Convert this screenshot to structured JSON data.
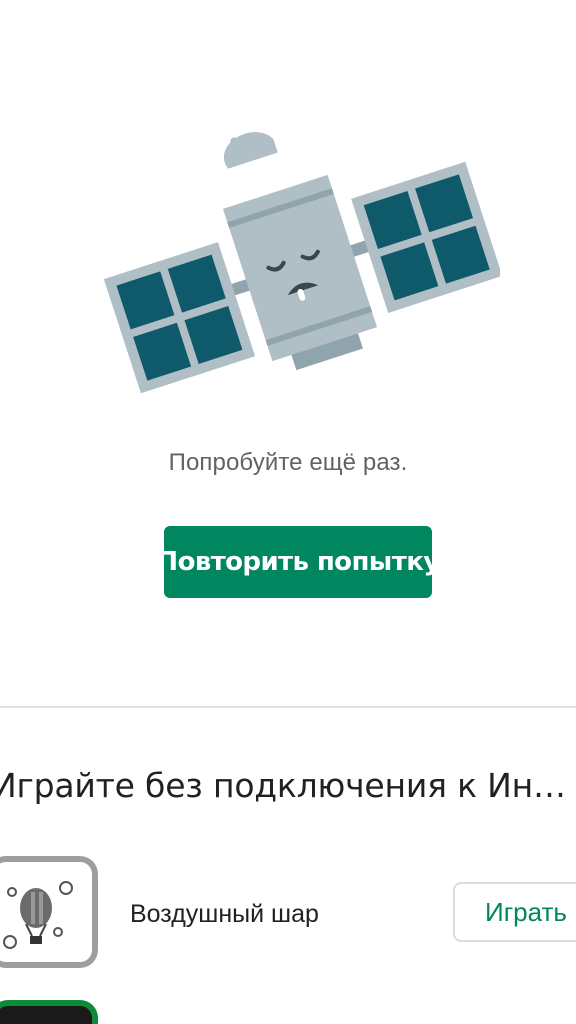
{
  "error": {
    "illustration": "sleeping-satellite-icon",
    "message": "Попробуйте ещё раз.",
    "retry_label": "Повторить попытку"
  },
  "offline": {
    "title": "Играйте без подключения к Инте..."
  },
  "games": [
    {
      "name": "Воздушный шар",
      "icon": "hot-air-balloon-icon",
      "play_label": "Играть"
    },
    {
      "icon": "game-icon"
    }
  ],
  "colors": {
    "accent": "#01875f",
    "text_primary": "#202124",
    "text_secondary": "#5f6368",
    "divider": "#e0e0e0",
    "satellite_body": "#b0bec5",
    "satellite_panel": "#0e5a6a"
  }
}
